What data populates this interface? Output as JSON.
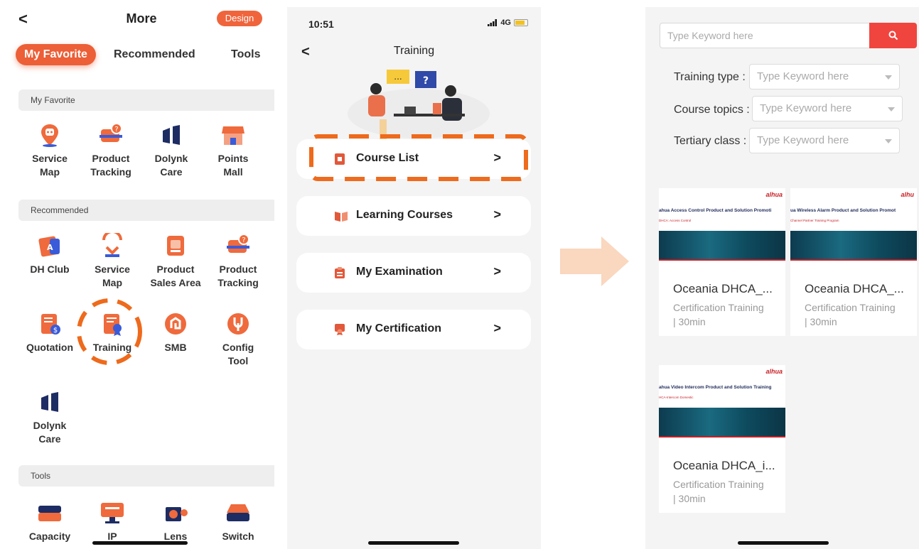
{
  "left": {
    "back_label": "<",
    "title": "More",
    "design_badge": "Design",
    "tabs": [
      "My Favorite",
      "Recommended",
      "Tools"
    ],
    "sections": {
      "favorite": "My Favorite",
      "recommended": "Recommended",
      "tools": "Tools"
    },
    "favorite_apps": [
      {
        "label": "Service\nMap",
        "icon": "service-map-icon"
      },
      {
        "label": "Product\nTracking",
        "icon": "product-tracking-icon"
      },
      {
        "label": "Dolynk\nCare",
        "icon": "dolynk-care-icon"
      },
      {
        "label": "Points\nMall",
        "icon": "points-mall-icon"
      }
    ],
    "recommended_apps": [
      {
        "label": "DH Club",
        "icon": "dh-club-icon"
      },
      {
        "label": "Service\nMap",
        "icon": "service-map-icon"
      },
      {
        "label": "Product\nSales Area",
        "icon": "product-sales-area-icon"
      },
      {
        "label": "Product\nTracking",
        "icon": "product-tracking-icon"
      },
      {
        "label": "Quotation",
        "icon": "quotation-icon"
      },
      {
        "label": "Training",
        "icon": "training-icon"
      },
      {
        "label": "SMB",
        "icon": "smb-icon"
      },
      {
        "label": "Config\nTool",
        "icon": "config-tool-icon"
      },
      {
        "label": "Dolynk\nCare",
        "icon": "dolynk-care-icon"
      }
    ],
    "tool_apps": [
      {
        "label": "Capacity",
        "icon": "capacity-icon"
      },
      {
        "label": "IP",
        "icon": "ip-icon"
      },
      {
        "label": "Lens",
        "icon": "lens-icon"
      },
      {
        "label": "Switch",
        "icon": "switch-icon"
      }
    ]
  },
  "middle": {
    "status_time": "10:51",
    "network": "4G",
    "back_label": "<",
    "title": "Training",
    "menu": [
      {
        "label": "Course List",
        "icon": "course-list-icon"
      },
      {
        "label": "Learning Courses",
        "icon": "learning-courses-icon"
      },
      {
        "label": "My Examination",
        "icon": "examination-icon"
      },
      {
        "label": "My Certification",
        "icon": "certification-icon"
      }
    ],
    "chevron": ">"
  },
  "right": {
    "search_placeholder": "Type Keyword here",
    "filters": [
      {
        "label": "Training type :",
        "placeholder": "Type Keyword here"
      },
      {
        "label": "Course topics :",
        "placeholder": "Type Keyword here"
      },
      {
        "label": "Tertiary class :",
        "placeholder": "Type Keyword here"
      }
    ],
    "courses": [
      {
        "thumb_title": "ahua Access Control Product and Solution Promoti",
        "thumb_sub": "DHCA: Access Control",
        "brand": "alhua",
        "name": "Oceania DHCA_...",
        "meta": "Certification Training\n| 30min"
      },
      {
        "thumb_title": "ua Wireless Alarm Product and Solution Promot",
        "thumb_sub": "Channel Partner Training Program",
        "brand": "alhu",
        "name": "Oceania DHCA_...",
        "meta": "Certification Training\n| 30min"
      },
      {
        "thumb_title": "ahua Video Intercom Product and Solution Training",
        "thumb_sub": "HCA-Intercom Domestic",
        "brand": "alhua",
        "name": "Oceania DHCA_i...",
        "meta": "Certification Training\n| 30min"
      }
    ]
  },
  "colors": {
    "accent": "#ec5f37",
    "highlight": "#ee6a1c",
    "search_button": "#f0453f",
    "arrow": "#fad7bf"
  }
}
